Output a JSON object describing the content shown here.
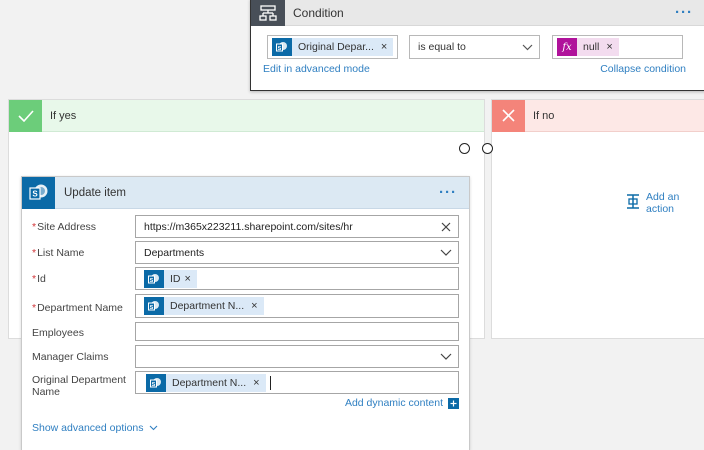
{
  "condition": {
    "title": "Condition",
    "left_token": "Original Depar...",
    "operator": "is equal to",
    "right_token": "null",
    "right_token_icon": "fx",
    "edit_advanced": "Edit in advanced mode",
    "collapse": "Collapse condition"
  },
  "branches": {
    "yes": {
      "label": "If yes"
    },
    "no": {
      "label": "If no",
      "add_action": "Add an action"
    }
  },
  "update": {
    "title": "Update item",
    "fields": {
      "site_address": {
        "label": "Site Address",
        "value": "https://m365x223211.sharepoint.com/sites/hr"
      },
      "list_name": {
        "label": "List Name",
        "value": "Departments"
      },
      "id": {
        "label": "Id",
        "token": "ID"
      },
      "department_name": {
        "label": "Department Name",
        "token": "Department N..."
      },
      "employees": {
        "label": "Employees",
        "value": ""
      },
      "manager_claims": {
        "label": "Manager Claims",
        "value": ""
      },
      "original_department_name": {
        "label": "Original Department Name",
        "token": "Department N..."
      }
    },
    "add_dynamic": "Add dynamic content",
    "show_advanced": "Show advanced options",
    "required_marker": "*",
    "remove_symbol": "×"
  },
  "colors": {
    "accent": "#2f7fc1",
    "sharepoint": "#0b6aa7",
    "yes": "#6ccd7a",
    "no": "#f4847a",
    "fx": "#b0129b"
  }
}
